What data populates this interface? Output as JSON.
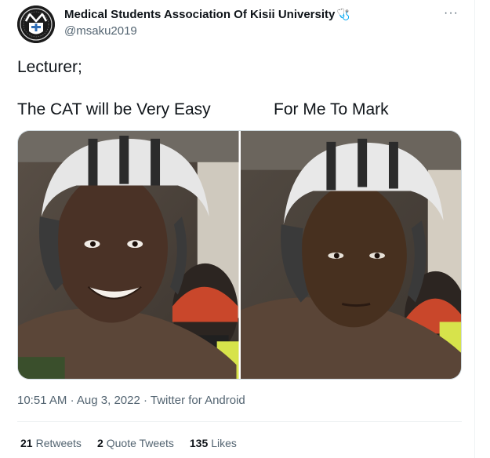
{
  "author": {
    "display_name": "Medical Students Association Of Kisii University",
    "name_emoji": "🩺",
    "handle": "@msaku2019"
  },
  "tweet": {
    "line1": "Lecturer;",
    "caption_left": "The CAT will be Very Easy",
    "caption_right": "For Me To Mark"
  },
  "meta": {
    "time": "10:51 AM",
    "dot1": "·",
    "date": "Aug 3, 2022",
    "dot2": "·",
    "source": "Twitter for Android"
  },
  "stats": {
    "retweets_count": "21",
    "retweets_label": "Retweets",
    "quotes_count": "2",
    "quotes_label": "Quote Tweets",
    "likes_count": "135",
    "likes_label": "Likes"
  },
  "icons": {
    "more": "more-horizontal-icon"
  },
  "colors": {
    "text_primary": "#0f1419",
    "text_secondary": "#536471",
    "border": "#cfd9de"
  }
}
